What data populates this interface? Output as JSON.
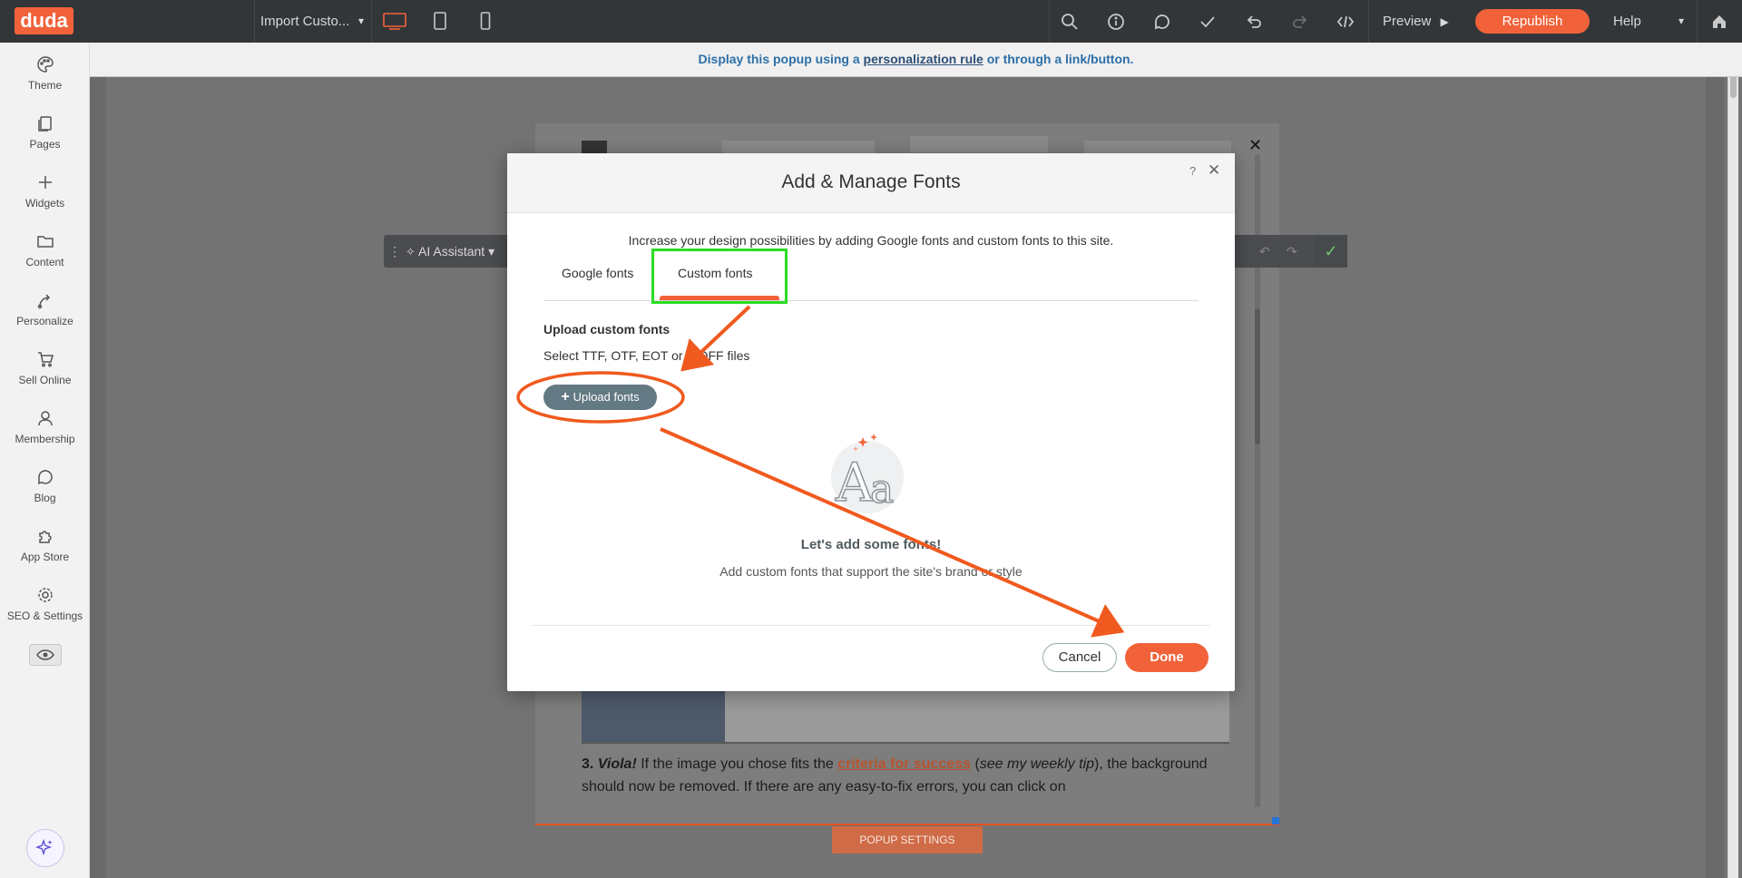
{
  "topbar": {
    "logo": "duda",
    "page_select": "Import Custo...",
    "preview": "Preview",
    "republish": "Republish",
    "help": "Help"
  },
  "sidebar": {
    "items": [
      {
        "label": "Theme",
        "icon": "palette-icon"
      },
      {
        "label": "Pages",
        "icon": "pages-icon"
      },
      {
        "label": "Widgets",
        "icon": "plus-icon"
      },
      {
        "label": "Content",
        "icon": "folder-icon"
      },
      {
        "label": "Personalize",
        "icon": "personalize-icon"
      },
      {
        "label": "Sell Online",
        "icon": "cart-icon"
      },
      {
        "label": "Membership",
        "icon": "user-icon"
      },
      {
        "label": "Blog",
        "icon": "chat-bubble-icon"
      },
      {
        "label": "App Store",
        "icon": "puzzle-icon"
      },
      {
        "label": "SEO & Settings",
        "icon": "gear-icon"
      }
    ]
  },
  "notice": {
    "prefix": "Display this popup using a",
    "link": "personalization rule",
    "suffix": "or through a link/button."
  },
  "floatbar": {
    "ai_label": "AI Assistant"
  },
  "background_text": {
    "step": "3.",
    "viola": "Viola!",
    "part1": "If the image you chose fits the",
    "link": "criteria for success",
    "part2": "(",
    "tip": "see my weekly tip",
    "part3": "), the background should now be removed. If there are any easy-to-fix errors, you can click on"
  },
  "popup_settings": "POPUP SETTINGS",
  "modal": {
    "title": "Add & Manage Fonts",
    "help": "?",
    "description": "Increase your design possibilities by adding Google fonts and custom fonts to this site.",
    "tabs": [
      "Google fonts",
      "Custom fonts"
    ],
    "active_tab": "Custom fonts",
    "upload_heading": "Upload custom fonts",
    "upload_sub": "Select TTF, OTF, EOT or WOFF files",
    "upload_button": "Upload fonts",
    "empty_title": "Let's add some fonts!",
    "empty_sub": "Add custom fonts that support the site's brand or style",
    "cancel": "Cancel",
    "done": "Done"
  },
  "colors": {
    "accent": "#f1623a",
    "topbar": "#333639",
    "annotation_green": "#2bdc24",
    "annotation_orange": "#f05a1e"
  }
}
